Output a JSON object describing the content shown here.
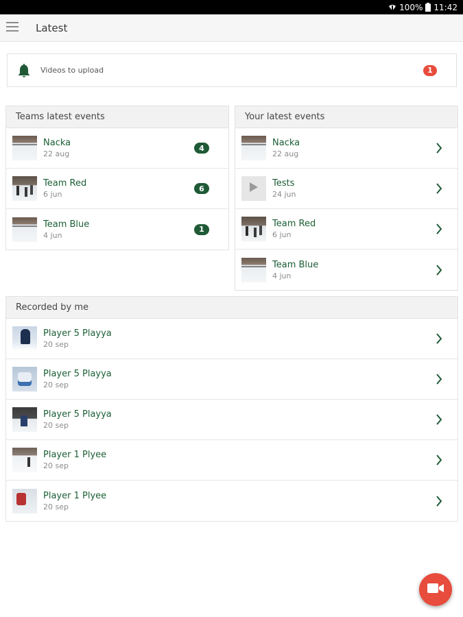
{
  "status_bar": {
    "battery": "100%",
    "time": "11:42"
  },
  "app_bar": {
    "title": "Latest",
    "menu_icon": "hamburger-menu-icon"
  },
  "upload_card": {
    "label": "Videos to upload",
    "count": "1",
    "icon": "bell-icon",
    "accent": "#1f5a36",
    "badge_color": "#e74c3c"
  },
  "teams_panel": {
    "header": "Teams latest events",
    "items": [
      {
        "title": "Nacka",
        "date": "22 aug",
        "count": "4"
      },
      {
        "title": "Team Red",
        "date": "6 jun",
        "count": "6"
      },
      {
        "title": "Team Blue",
        "date": "4 jun",
        "count": "1"
      }
    ]
  },
  "your_panel": {
    "header": "Your latest events",
    "items": [
      {
        "title": "Nacka",
        "date": "22 aug"
      },
      {
        "title": "Tests",
        "date": "24 jun"
      },
      {
        "title": "Team Red",
        "date": "6 jun"
      },
      {
        "title": "Team Blue",
        "date": "4 jun"
      }
    ]
  },
  "recorded_panel": {
    "header": "Recorded by me",
    "items": [
      {
        "title": "Player 5 Playya",
        "date": "20 sep"
      },
      {
        "title": "Player 5 Playya",
        "date": "20 sep"
      },
      {
        "title": "Player 5 Playya",
        "date": "20 sep"
      },
      {
        "title": "Player 1 Plyee",
        "date": "20 sep"
      },
      {
        "title": "Player 1 Plyee",
        "date": "20 sep"
      }
    ]
  },
  "fab": {
    "icon": "video-camera-icon",
    "color": "#e74c3c"
  }
}
